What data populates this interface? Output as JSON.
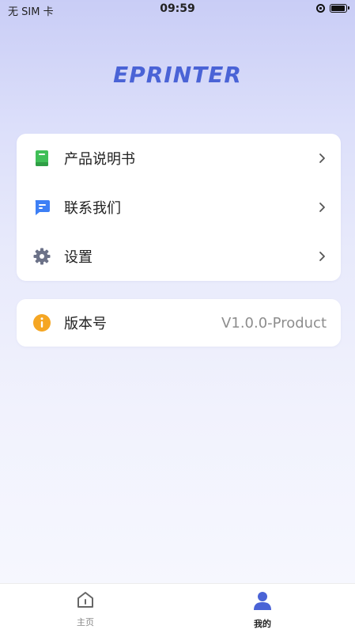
{
  "status_bar": {
    "carrier": "无 SIM 卡",
    "time": "09:59"
  },
  "brand": {
    "logo_text": "EPRINTER",
    "accent_color": "#4a63d6"
  },
  "menu": {
    "items": [
      {
        "label": "产品说明书",
        "icon": "book-icon",
        "icon_color": "#3fbf57"
      },
      {
        "label": "联系我们",
        "icon": "chat-message-icon",
        "icon_color": "#3d7ff5"
      },
      {
        "label": "设置",
        "icon": "gear-icon",
        "icon_color": "#6c7288"
      }
    ]
  },
  "version": {
    "label": "版本号",
    "value": "V1.0.0-Product",
    "icon": "info-icon",
    "icon_color": "#f5a623"
  },
  "tab_bar": {
    "tabs": [
      {
        "label": "主页",
        "icon": "home-icon",
        "active": false
      },
      {
        "label": "我的",
        "icon": "user-icon",
        "active": true
      }
    ],
    "active_color": "#4a63d6"
  }
}
